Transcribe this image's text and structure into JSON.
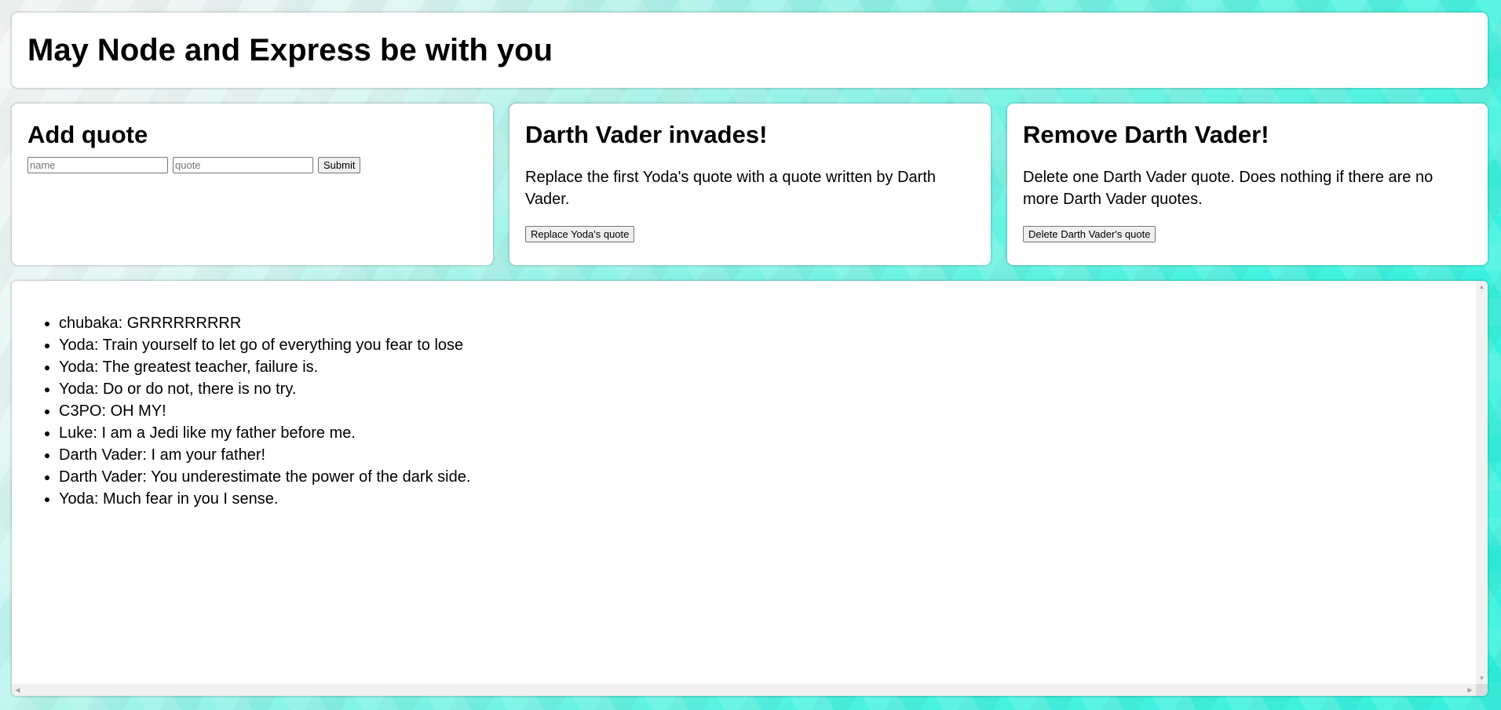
{
  "header": {
    "title": "May Node and Express be with you"
  },
  "add_quote": {
    "title": "Add quote",
    "name_placeholder": "name",
    "quote_placeholder": "quote",
    "submit_label": "Submit"
  },
  "vader_invades": {
    "title": "Darth Vader invades!",
    "description": "Replace the first Yoda's quote with a quote written by Darth Vader.",
    "button_label": "Replace Yoda's quote"
  },
  "remove_vader": {
    "title": "Remove Darth Vader!",
    "description": "Delete one Darth Vader quote. Does nothing if there are no more Darth Vader quotes.",
    "button_label": "Delete Darth Vader's quote"
  },
  "quotes": [
    "chubaka: GRRRRRRRRR",
    "Yoda: Train yourself to let go of everything you fear to lose",
    "Yoda: The greatest teacher, failure is.",
    "Yoda: Do or do not, there is no try.",
    "C3PO: OH MY!",
    "Luke: I am a Jedi like my father before me.",
    "Darth Vader: I am your father!",
    "Darth Vader: You underestimate the power of the dark side.",
    "Yoda: Much fear in you I sense."
  ],
  "colors": {
    "background_accent": "#3ff2df",
    "card_background": "#ffffff"
  },
  "icons": {
    "scroll_up": "scroll-up-arrow-icon",
    "scroll_down": "scroll-down-arrow-icon",
    "scroll_left": "scroll-left-arrow-icon",
    "scroll_right": "scroll-right-arrow-icon"
  }
}
